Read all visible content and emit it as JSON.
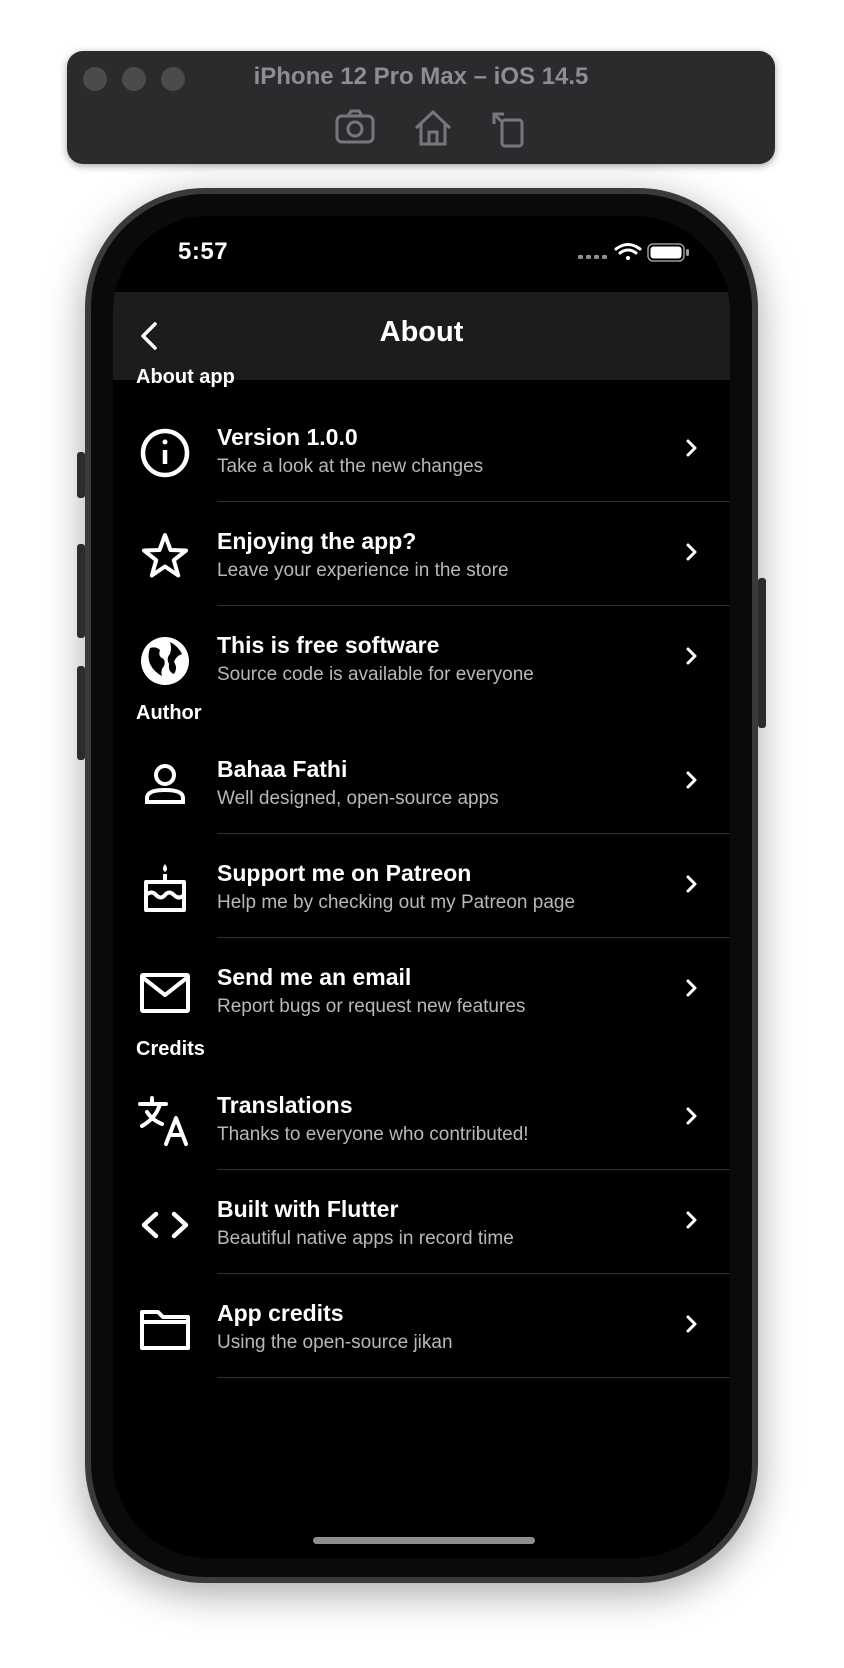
{
  "simulator": {
    "title": "iPhone 12 Pro Max – iOS 14.5",
    "buttons": [
      "screenshot-icon",
      "home-icon",
      "rotate-icon"
    ]
  },
  "status_bar": {
    "time": "5:57",
    "icons": [
      "signal-icon",
      "wifi-icon",
      "battery-icon"
    ]
  },
  "app_bar": {
    "title": "About",
    "back_icon": "chevron-left-icon"
  },
  "sections": [
    {
      "header": "About app",
      "items": [
        {
          "icon": "info-icon",
          "title": "Version 1.0.0",
          "subtitle": "Take a look at the new changes"
        },
        {
          "icon": "star-icon",
          "title": "Enjoying the app?",
          "subtitle": "Leave your experience in the store"
        },
        {
          "icon": "globe-icon",
          "title": "This is free software",
          "subtitle": "Source code is available for everyone"
        }
      ]
    },
    {
      "header": "Author",
      "items": [
        {
          "icon": "person-icon",
          "title": "Bahaa Fathi",
          "subtitle": "Well designed, open-source apps"
        },
        {
          "icon": "cake-icon",
          "title": "Support me on Patreon",
          "subtitle": "Help me by checking out my Patreon page"
        },
        {
          "icon": "mail-icon",
          "title": "Send me an email",
          "subtitle": "Report bugs or request new features"
        }
      ]
    },
    {
      "header": "Credits",
      "items": [
        {
          "icon": "translate-icon",
          "title": "Translations",
          "subtitle": "Thanks to everyone who contributed!"
        },
        {
          "icon": "code-icon",
          "title": "Built with Flutter",
          "subtitle": "Beautiful native apps in record time"
        },
        {
          "icon": "folder-icon",
          "title": "App credits",
          "subtitle": "Using the open-source jikan"
        }
      ]
    }
  ],
  "colors": {
    "background": "#000000",
    "app_bar": "#1c1c1e",
    "text_primary": "#ffffff",
    "text_secondary": "#b8b8bc",
    "divider": "#2e2e30"
  }
}
